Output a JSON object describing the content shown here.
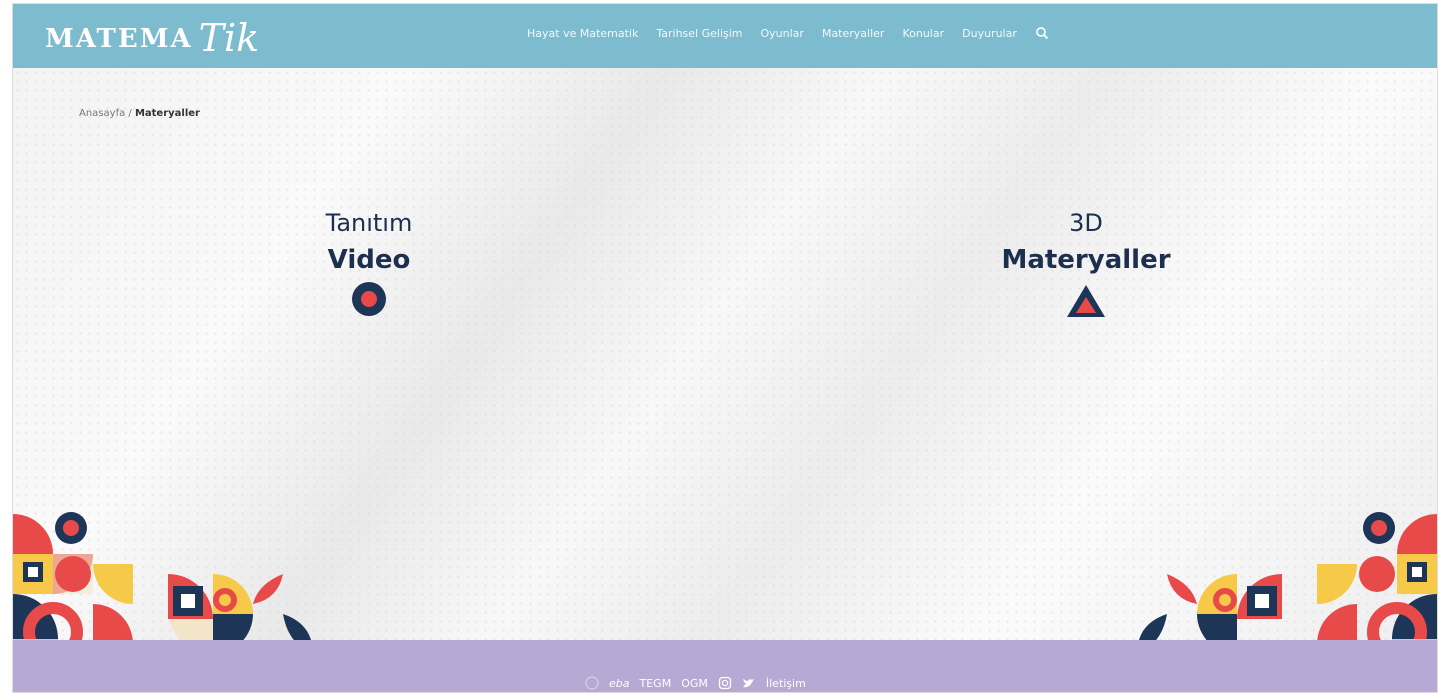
{
  "header": {
    "logo_text": "MATEMA",
    "logo_script": "Tik",
    "nav": [
      {
        "label": "Hayat ve Matematik"
      },
      {
        "label": "Tarihsel Gelişim"
      },
      {
        "label": "Oyunlar"
      },
      {
        "label": "Materyaller"
      },
      {
        "label": "Konular"
      },
      {
        "label": "Duyurular"
      }
    ]
  },
  "breadcrumb": {
    "home": "Anasayfa",
    "separator": " / ",
    "current": "Materyaller"
  },
  "cards": [
    {
      "top": "Tanıtım",
      "bottom": "Video",
      "icon": "circle-icon"
    },
    {
      "top": "3D",
      "bottom": "Materyaller",
      "icon": "triangle-icon"
    }
  ],
  "footer": {
    "links": [
      {
        "label": "eba"
      },
      {
        "label": "TEGM"
      },
      {
        "label": "OGM"
      },
      {
        "label": "İletişim"
      }
    ],
    "icons": [
      "meb-logo-icon",
      "instagram-icon",
      "twitter-icon"
    ]
  },
  "colors": {
    "header": "#7cbcce",
    "footer": "#b8a8d4",
    "navy": "#1d3557",
    "red": "#e84a4a",
    "yellow": "#f7c948",
    "cream": "#f3e6c8"
  }
}
